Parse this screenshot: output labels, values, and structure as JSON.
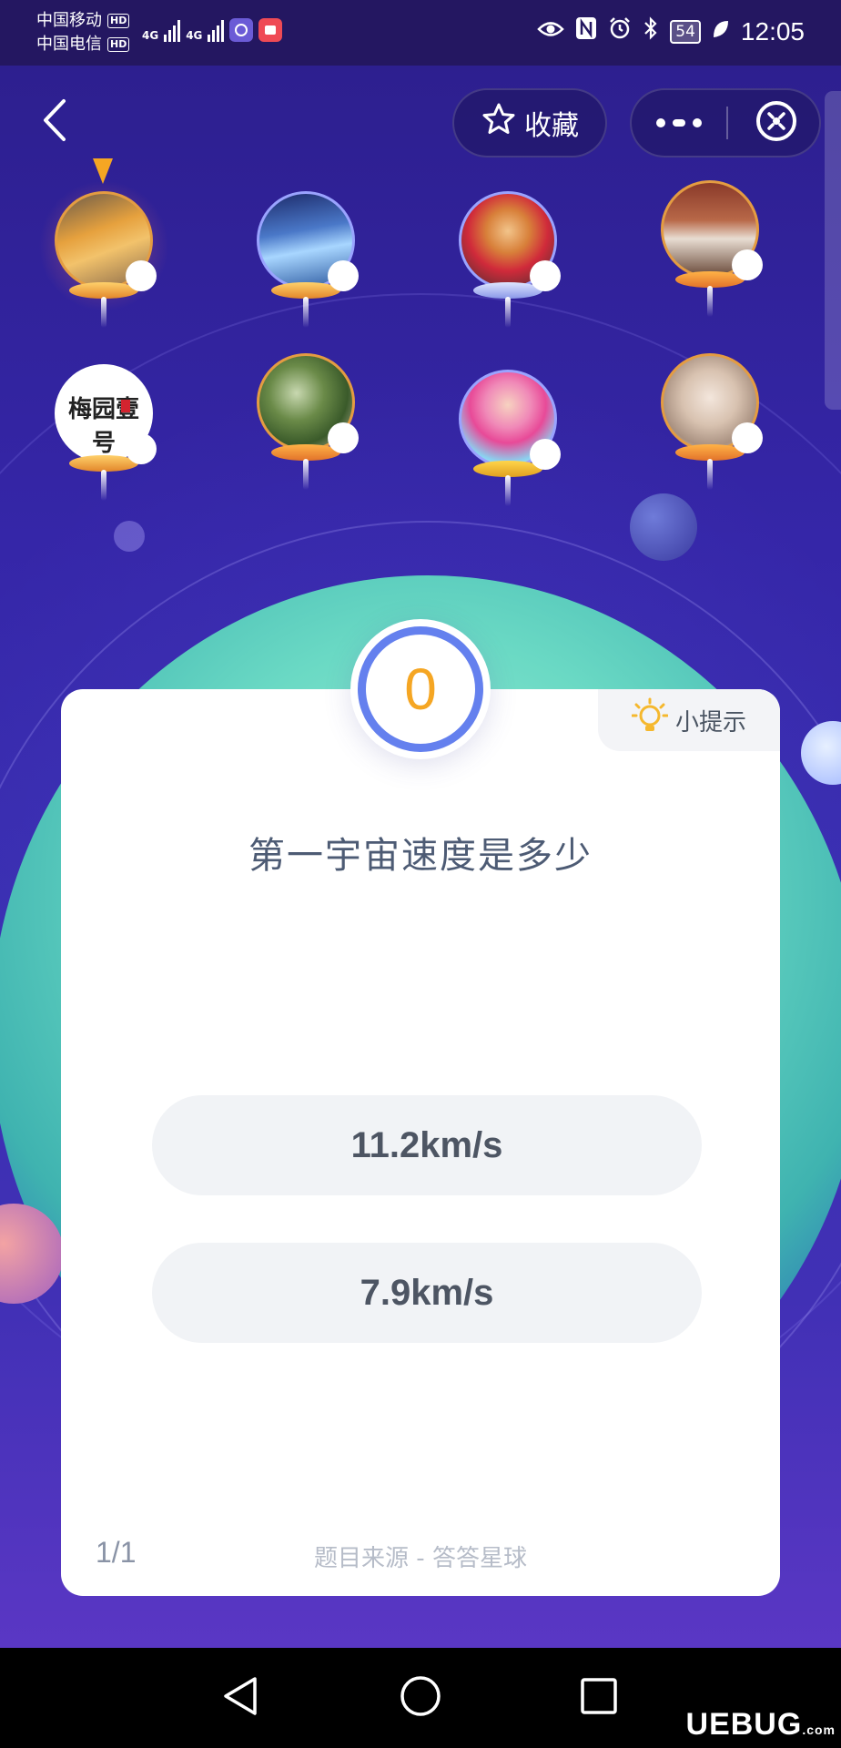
{
  "status_bar": {
    "carrier_1": "中国移动",
    "carrier_2": "中国电信",
    "hd_badge": "HD",
    "network_1": "4G",
    "network_2": "4G",
    "battery_level": "54",
    "time": "12:05",
    "icons": [
      "eye-icon",
      "nfc-icon",
      "alarm-icon",
      "bluetooth-icon",
      "battery-icon",
      "leaf-icon"
    ]
  },
  "topbar": {
    "favorite_label": "收藏",
    "icons": [
      "back-arrow-icon",
      "star-icon",
      "more-icon",
      "close-circle-icon"
    ]
  },
  "avatars": [
    {
      "stamp_text": ""
    },
    {
      "stamp_text": ""
    },
    {
      "stamp_text": ""
    },
    {
      "stamp_text": ""
    },
    {
      "stamp_text": "梅园壹号"
    },
    {
      "stamp_text": ""
    },
    {
      "stamp_text": ""
    },
    {
      "stamp_text": ""
    }
  ],
  "quiz": {
    "timer": "0",
    "hint_label": "小提示",
    "question": "第一宇宙速度是多少",
    "options": [
      "11.2km/s",
      "7.9km/s"
    ],
    "progress": "1/1",
    "source": "题目来源 - 答答星球"
  },
  "nav_bar": {
    "icons": [
      "back-triangle-icon",
      "home-circle-icon",
      "recents-square-icon"
    ],
    "watermark": "UEBUG",
    "watermark_suffix": ".com"
  },
  "colors": {
    "accent_blue": "#6480ee",
    "timer_orange": "#f5a623",
    "background_purple": "#3526a8"
  }
}
